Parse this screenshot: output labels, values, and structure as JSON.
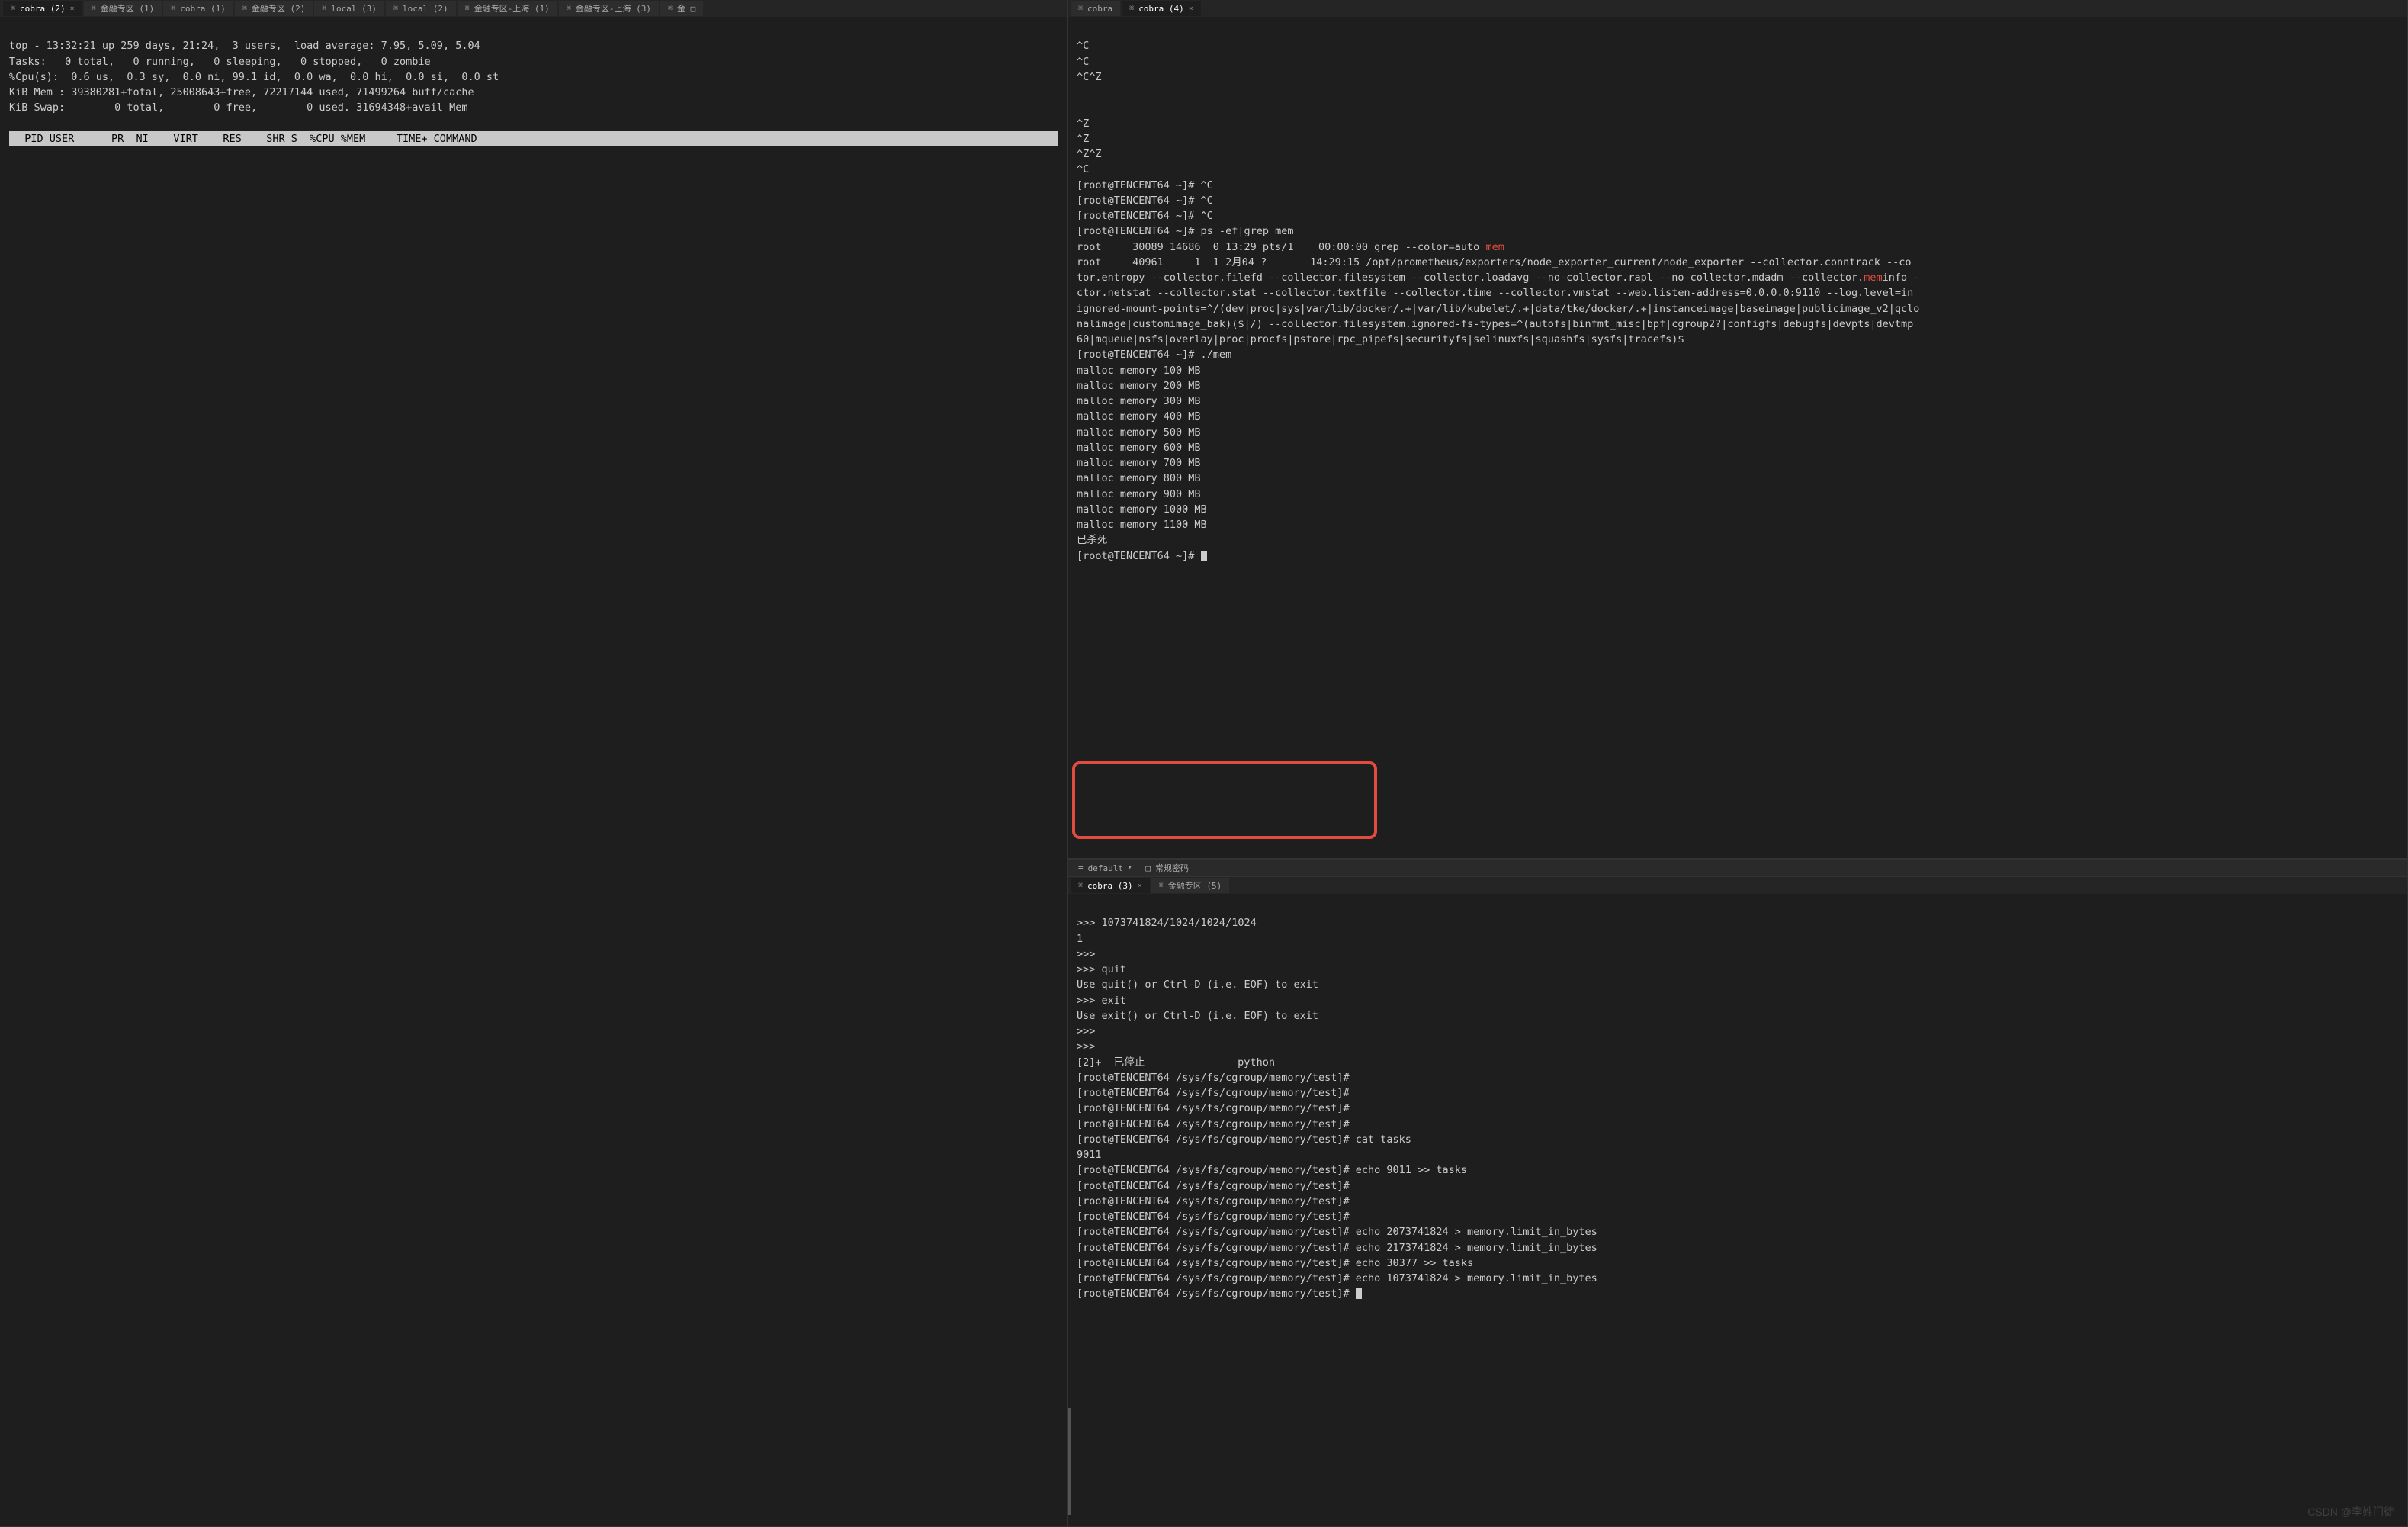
{
  "tabs": {
    "top": [
      {
        "label": "cobra (2)",
        "active": true,
        "close": true
      },
      {
        "label": "金融专区 (1)"
      },
      {
        "label": "cobra (1)"
      },
      {
        "label": "金融专区 (2)"
      },
      {
        "label": "local (3)"
      },
      {
        "label": "local (2)"
      },
      {
        "label": "金融专区-上海 (1)"
      },
      {
        "label": "金融专区-上海 (3)"
      },
      {
        "label": "金 □"
      }
    ],
    "right_top": [
      {
        "label": "cobra"
      },
      {
        "label": "cobra (4)",
        "active": true,
        "close": true
      }
    ],
    "right_bottom": [
      {
        "label": "cobra (3)",
        "active": true,
        "close": true
      },
      {
        "label": "金融专区 (5)"
      }
    ]
  },
  "toolbar": {
    "left_icon": "≡",
    "name": "default",
    "icon2": "□",
    "btn2": "常规密码"
  },
  "left_terminal": {
    "line1": "top - 13:32:21 up 259 days, 21:24,  3 users,  load average: 7.95, 5.09, 5.04",
    "line2": "Tasks:   0 total,   0 running,   0 sleeping,   0 stopped,   0 zombie",
    "line3": "%Cpu(s):  0.6 us,  0.3 sy,  0.0 ni, 99.1 id,  0.0 wa,  0.0 hi,  0.0 si,  0.0 st",
    "line4": "KiB Mem : 39380281+total, 25008643+free, 72217144 used, 71499264 buff/cache",
    "line5": "KiB Swap:        0 total,        0 free,        0 used. 31694348+avail Mem",
    "header": "  PID USER      PR  NI    VIRT    RES    SHR S  %CPU %MEM     TIME+ COMMAND"
  },
  "right_top_terminal": {
    "pre_lines": "^C\n^C\n^C^Z\n\n\n^Z\n^Z\n^Z^Z\n^C",
    "p1": "[root@TENCENT64 ~]# ^C",
    "p2": "[root@TENCENT64 ~]# ^C",
    "p3": "[root@TENCENT64 ~]# ^C",
    "p4": "[root@TENCENT64 ~]# ps -ef|grep mem",
    "grep_line_a": "root     30089 14686  0 13:29 pts/1    00:00:00 grep --color=auto ",
    "grep_line_b": "mem",
    "line6": "root     40961     1  1 2月04 ?       14:29:15 /opt/prometheus/exporters/node_exporter_current/node_exporter --collector.conntrack --co",
    "line7a": "tor.entropy --collector.filefd --collector.filesystem --collector.loadavg --no-collector.rapl --no-collector.mdadm --collector.",
    "line7b": "mem",
    "line7c": "info -",
    "line8": "ctor.netstat --collector.stat --collector.textfile --collector.time --collector.vmstat --web.listen-address=0.0.0.0:9110 --log.level=in",
    "line9": "ignored-mount-points=^/(dev|proc|sys|var/lib/docker/.+|var/lib/kubelet/.+|data/tke/docker/.+|instanceimage|baseimage|publicimage_v2|qclo",
    "line10": "nalimage|customimage_bak)($|/) --collector.filesystem.ignored-fs-types=^(autofs|binfmt_misc|bpf|cgroup2?|configfs|debugfs|devpts|devtmp",
    "line11": "60|mqueue|nsfs|overlay|proc|procfs|pstore|rpc_pipefs|securityfs|selinuxfs|squashfs|sysfs|tracefs)$",
    "line12": "[root@TENCENT64 ~]# ./mem",
    "m1": "malloc memory 100 MB",
    "m2": "malloc memory 200 MB",
    "m3": "malloc memory 300 MB",
    "m4": "malloc memory 400 MB",
    "m5": "malloc memory 500 MB",
    "m6": "malloc memory 600 MB",
    "m7": "malloc memory 700 MB",
    "m8": "malloc memory 800 MB",
    "m9": "malloc memory 900 MB",
    "m10": "malloc memory 1000 MB",
    "m11": "malloc memory 1100 MB",
    "killed": "已杀死",
    "prompt_end": "[root@TENCENT64 ~]# "
  },
  "right_bottom_terminal": {
    "l1": ">>> 1073741824/1024/1024/1024",
    "l2": "1",
    "l3": ">>>",
    "l4": ">>> quit",
    "l5": "Use quit() or Ctrl-D (i.e. EOF) to exit",
    "l6": ">>> exit",
    "l7": "Use exit() or Ctrl-D (i.e. EOF) to exit",
    "l8": ">>>",
    "l9": ">>>",
    "l10": "[2]+  已停止               python",
    "l11": "[root@TENCENT64 /sys/fs/cgroup/memory/test]#",
    "l12": "[root@TENCENT64 /sys/fs/cgroup/memory/test]#",
    "l13": "[root@TENCENT64 /sys/fs/cgroup/memory/test]#",
    "l14": "[root@TENCENT64 /sys/fs/cgroup/memory/test]#",
    "l15": "[root@TENCENT64 /sys/fs/cgroup/memory/test]# cat tasks",
    "l16": "9011",
    "l17": "[root@TENCENT64 /sys/fs/cgroup/memory/test]# echo 9011 >> tasks",
    "l18": "[root@TENCENT64 /sys/fs/cgroup/memory/test]#",
    "l19": "[root@TENCENT64 /sys/fs/cgroup/memory/test]#",
    "l20": "[root@TENCENT64 /sys/fs/cgroup/memory/test]#",
    "l21": "[root@TENCENT64 /sys/fs/cgroup/memory/test]# echo 2073741824 > memory.limit_in_bytes",
    "l22": "[root@TENCENT64 /sys/fs/cgroup/memory/test]# echo 2173741824 > memory.limit_in_bytes",
    "l23": "[root@TENCENT64 /sys/fs/cgroup/memory/test]# echo 30377 >> tasks",
    "l24": "[root@TENCENT64 /sys/fs/cgroup/memory/test]# echo 1073741824 > memory.limit_in_bytes",
    "l25": "[root@TENCENT64 /sys/fs/cgroup/memory/test]# "
  },
  "watermark": "CSDN @李姓门徒"
}
